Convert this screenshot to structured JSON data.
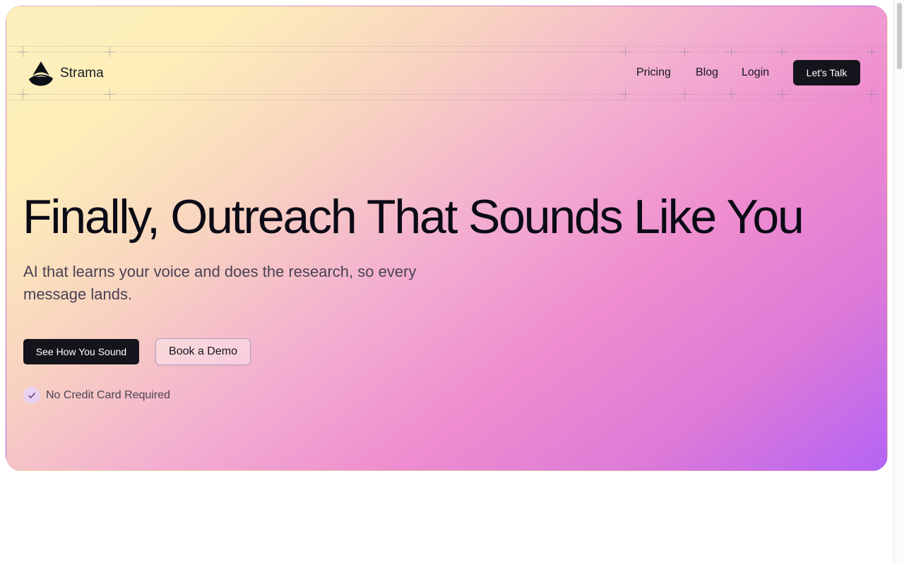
{
  "brand": {
    "name": "Strama",
    "logo_icon": "strama-logo-icon"
  },
  "nav": {
    "links": [
      "Pricing",
      "Blog",
      "Login"
    ],
    "cta_label": "Let's Talk"
  },
  "hero": {
    "headline": "Finally, Outreach That Sounds Like You",
    "subhead": "AI that learns your voice and does the research, so every message lands.",
    "primary_button": "See How You Sound",
    "secondary_button": "Book a Demo",
    "note": "No Credit Card Required",
    "note_icon": "check-icon"
  },
  "colors": {
    "dark": "#14141c",
    "gradient_start": "#fdf0bd",
    "gradient_mid": "#ee8ccf",
    "gradient_end": "#b463f5"
  }
}
